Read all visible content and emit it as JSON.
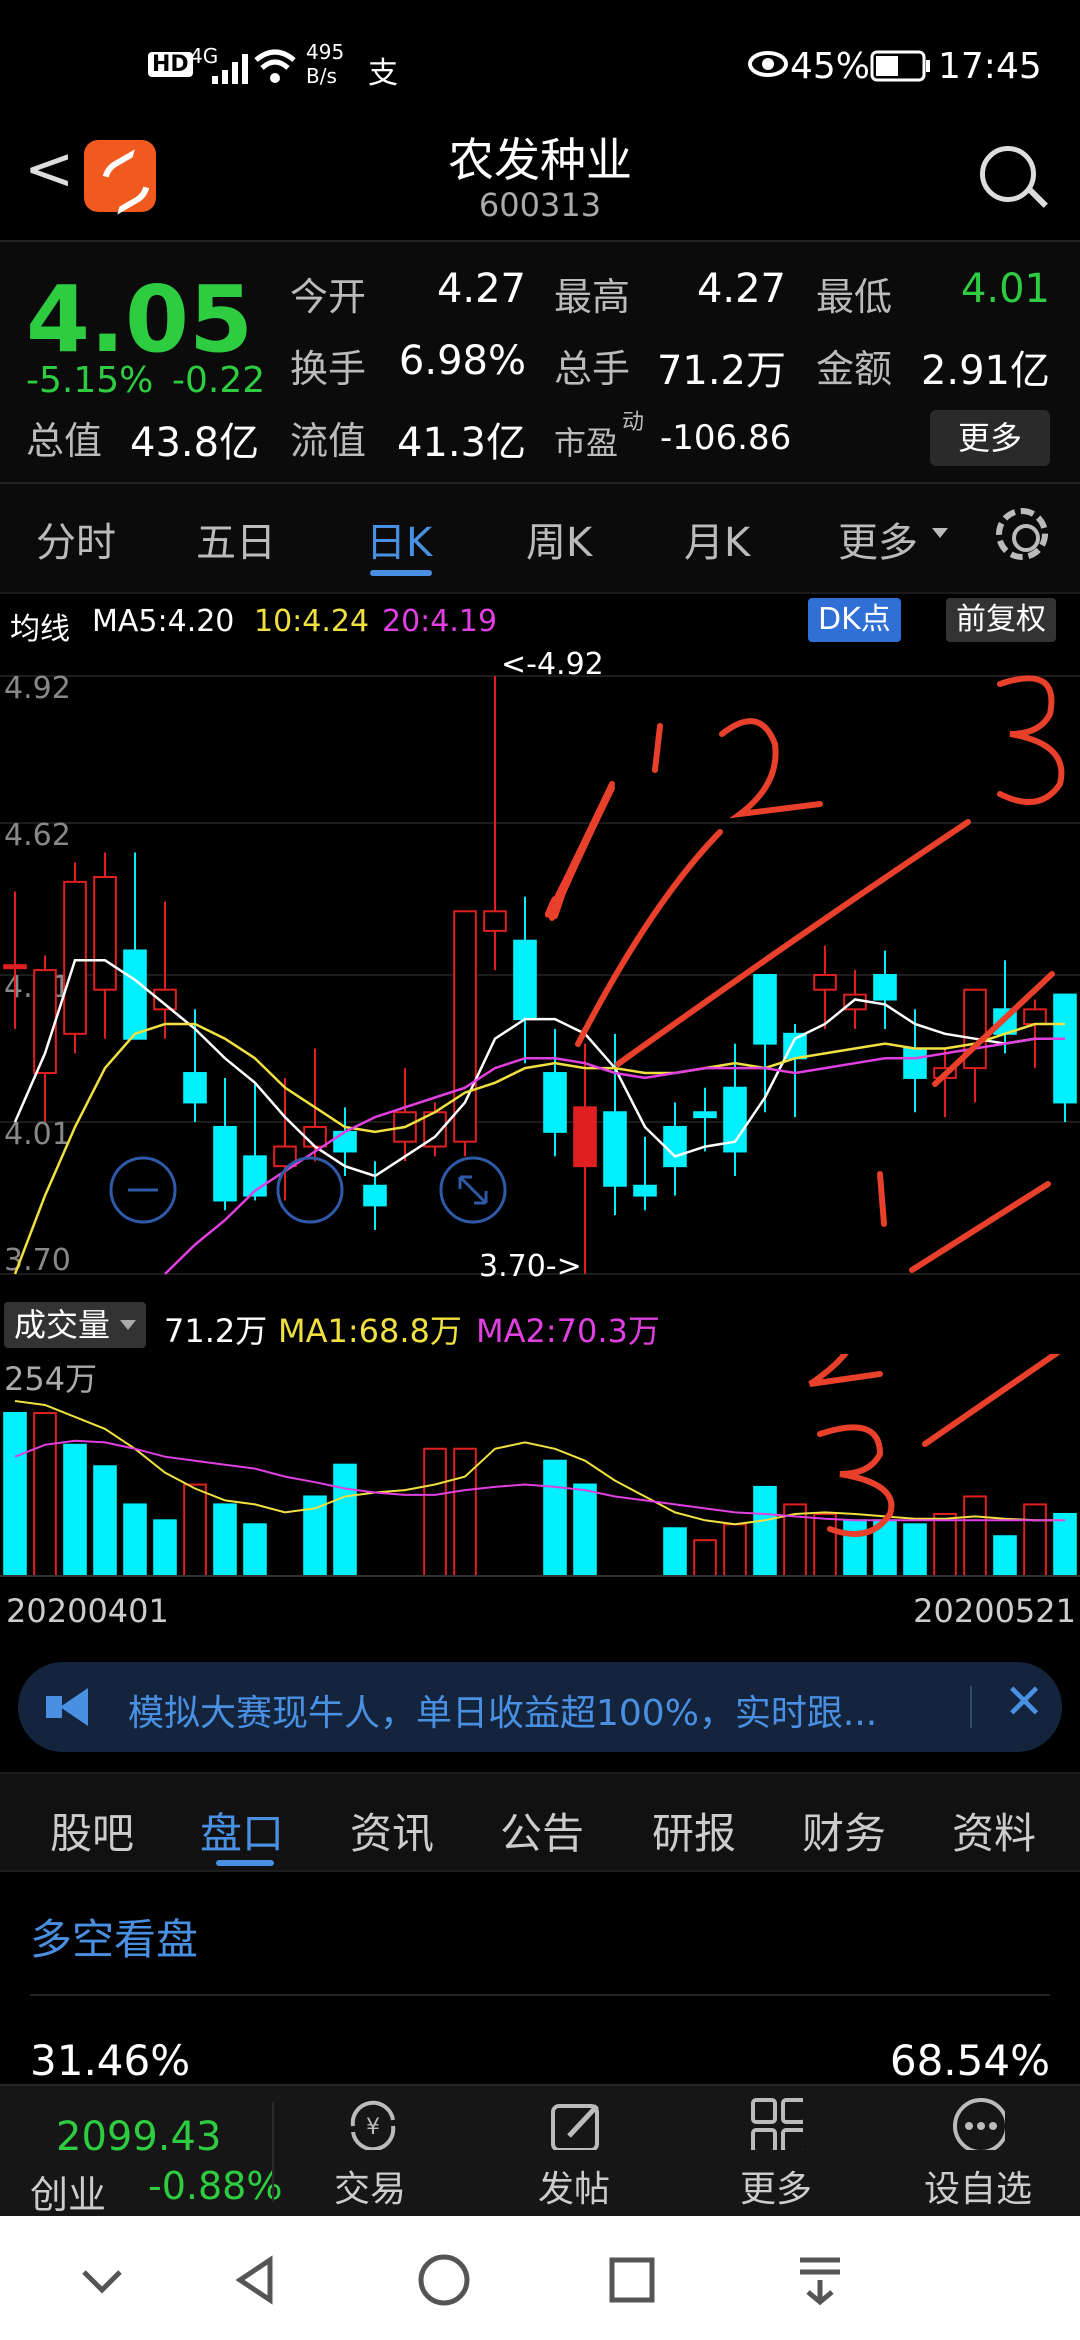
{
  "status_bar": {
    "hd": "HD",
    "network": "4G",
    "speed_value": "495",
    "speed_unit": "B/s",
    "pay_icon": "支",
    "battery": "45%",
    "time": "17:45"
  },
  "header": {
    "title": "农发种业",
    "code": "600313"
  },
  "quote": {
    "price": "4.05",
    "change_pct": "-5.15%",
    "change": "-0.22",
    "fields": {
      "open_label": "今开",
      "open": "4.27",
      "high_label": "最高",
      "high": "4.27",
      "low_label": "最低",
      "low": "4.01",
      "turnover_label": "换手",
      "turnover": "6.98%",
      "volume_label": "总手",
      "volume": "71.2万",
      "amount_label": "金额",
      "amount": "2.91亿",
      "mktcap_label": "总值",
      "mktcap": "43.8亿",
      "float_label": "流值",
      "float": "41.3亿",
      "pe_label": "市盈",
      "pe_sup": "动",
      "pe": "-106.86"
    },
    "more_label": "更多"
  },
  "period_tabs": [
    "分时",
    "五日",
    "日K",
    "周K",
    "月K",
    "更多"
  ],
  "active_period": "日K",
  "ma_bar": {
    "label": "均线",
    "ma5": "MA5:4.20",
    "ma10": "10:4.24",
    "ma20": "20:4.19",
    "dk_label": "DK点",
    "fq_label": "前复权"
  },
  "colors": {
    "up": "#e02020",
    "down": "#00f0ff",
    "ma5": "#ffffff",
    "ma10": "#f0e040",
    "ma20": "#e040e0",
    "accent": "#4a90e2",
    "green": "#2ecc40",
    "annotation": "#e8402a"
  },
  "chart_data": {
    "type": "candlestick",
    "y_ticks": [
      "4.92",
      "4.62",
      "4.31",
      "4.01",
      "3.70"
    ],
    "ylim": [
      3.7,
      4.92
    ],
    "max_label": "<-4.92",
    "min_label": "3.70->",
    "start_date": "20200401",
    "end_date": "20200521",
    "candles": [
      {
        "o": 4.33,
        "h": 4.48,
        "l": 4.2,
        "c": 4.33,
        "d": 1
      },
      {
        "o": 4.11,
        "h": 4.35,
        "l": 4.01,
        "c": 4.32,
        "d": 1
      },
      {
        "o": 4.19,
        "h": 4.54,
        "l": 4.15,
        "c": 4.5,
        "d": 1
      },
      {
        "o": 4.28,
        "h": 4.56,
        "l": 4.18,
        "c": 4.51,
        "d": 1
      },
      {
        "o": 4.36,
        "h": 4.56,
        "l": 4.19,
        "c": 4.18,
        "d": -1
      },
      {
        "o": 4.24,
        "h": 4.46,
        "l": 4.18,
        "c": 4.28,
        "d": 1
      },
      {
        "o": 4.11,
        "h": 4.24,
        "l": 4.01,
        "c": 4.05,
        "d": -1
      },
      {
        "o": 4.0,
        "h": 4.1,
        "l": 3.83,
        "c": 3.85,
        "d": -1
      },
      {
        "o": 3.94,
        "h": 4.09,
        "l": 3.85,
        "c": 3.86,
        "d": -1
      },
      {
        "o": 3.92,
        "h": 4.1,
        "l": 3.85,
        "c": 3.96,
        "d": 1
      },
      {
        "o": 3.96,
        "h": 4.16,
        "l": 3.93,
        "c": 4.0,
        "d": 1
      },
      {
        "o": 3.99,
        "h": 4.04,
        "l": 3.9,
        "c": 3.95,
        "d": -1
      },
      {
        "o": 3.88,
        "h": 3.93,
        "l": 3.79,
        "c": 3.84,
        "d": -1
      },
      {
        "o": 3.97,
        "h": 4.12,
        "l": 3.93,
        "c": 4.03,
        "d": 1
      },
      {
        "o": 3.96,
        "h": 4.05,
        "l": 3.94,
        "c": 4.03,
        "d": 1
      },
      {
        "o": 3.97,
        "h": 4.44,
        "l": 3.94,
        "c": 4.44,
        "d": 1
      },
      {
        "o": 4.4,
        "h": 4.92,
        "l": 4.32,
        "c": 4.44,
        "d": 1
      },
      {
        "o": 4.38,
        "h": 4.47,
        "l": 4.13,
        "c": 4.22,
        "d": -1
      },
      {
        "o": 4.11,
        "h": 4.2,
        "l": 3.94,
        "c": 3.99,
        "d": -1
      },
      {
        "o": 4.04,
        "h": 4.17,
        "l": 3.7,
        "c": 3.92,
        "d": 1
      },
      {
        "o": 3.88,
        "h": 4.19,
        "l": 3.82,
        "c": 4.03,
        "d": -1
      },
      {
        "o": 3.88,
        "h": 3.98,
        "l": 3.83,
        "c": 3.86,
        "d": -1
      },
      {
        "o": 3.92,
        "h": 4.05,
        "l": 3.86,
        "c": 4.0,
        "d": -1
      },
      {
        "o": 4.02,
        "h": 4.08,
        "l": 3.95,
        "c": 4.03,
        "d": -1
      },
      {
        "o": 3.95,
        "h": 4.17,
        "l": 3.9,
        "c": 4.08,
        "d": -1
      },
      {
        "o": 4.17,
        "h": 4.31,
        "l": 4.03,
        "c": 4.31,
        "d": -1
      },
      {
        "o": 4.14,
        "h": 4.21,
        "l": 4.02,
        "c": 4.19,
        "d": -1
      },
      {
        "o": 4.28,
        "h": 4.37,
        "l": 4.2,
        "c": 4.31,
        "d": 1
      },
      {
        "o": 4.24,
        "h": 4.32,
        "l": 4.2,
        "c": 4.27,
        "d": 1
      },
      {
        "o": 4.31,
        "h": 4.36,
        "l": 4.2,
        "c": 4.26,
        "d": -1
      },
      {
        "o": 4.16,
        "h": 4.24,
        "l": 4.03,
        "c": 4.1,
        "d": -1
      },
      {
        "o": 4.1,
        "h": 4.16,
        "l": 4.02,
        "c": 4.12,
        "d": 1
      },
      {
        "o": 4.12,
        "h": 4.25,
        "l": 4.05,
        "c": 4.28,
        "d": 1
      },
      {
        "o": 4.24,
        "h": 4.34,
        "l": 4.15,
        "c": 4.19,
        "d": -1
      },
      {
        "o": 4.21,
        "h": 4.26,
        "l": 4.12,
        "c": 4.24,
        "d": 1
      },
      {
        "o": 4.27,
        "h": 4.27,
        "l": 4.01,
        "c": 4.05,
        "d": -1
      }
    ],
    "ma5_series": [
      4.01,
      4.15,
      4.34,
      4.34,
      4.3,
      4.25,
      4.2,
      4.14,
      4.09,
      4.02,
      3.96,
      3.92,
      3.9,
      3.94,
      3.98,
      4.05,
      4.18,
      4.22,
      4.22,
      4.19,
      4.12,
      4.0,
      3.94,
      3.96,
      3.97,
      4.06,
      4.18,
      4.21,
      4.26,
      4.25,
      4.21,
      4.19,
      4.18,
      4.17,
      4.18,
      4.18
    ],
    "ma10_series": [
      3.7,
      3.86,
      4.0,
      4.12,
      4.19,
      4.21,
      4.21,
      4.18,
      4.14,
      4.08,
      4.04,
      4.0,
      3.99,
      4.0,
      4.03,
      4.07,
      4.09,
      4.12,
      4.13,
      4.12,
      4.12,
      4.11,
      4.11,
      4.12,
      4.13,
      4.12,
      4.14,
      4.15,
      4.16,
      4.17,
      4.16,
      4.16,
      4.17,
      4.19,
      4.21,
      4.21
    ],
    "ma20_series": [
      null,
      null,
      null,
      null,
      null,
      3.7,
      3.76,
      3.81,
      3.87,
      3.91,
      3.95,
      3.99,
      4.02,
      4.04,
      4.06,
      4.08,
      4.12,
      4.14,
      4.14,
      4.13,
      4.11,
      4.1,
      4.11,
      4.12,
      4.12,
      4.12,
      4.11,
      4.12,
      4.13,
      4.14,
      4.14,
      4.15,
      4.16,
      4.17,
      4.18,
      4.18
    ]
  },
  "volume": {
    "selector_label": "成交量",
    "vol": "71.2万",
    "ma1": "MA1:68.8万",
    "ma2": "MA2:70.3万",
    "max_tick": "254万",
    "bars": [
      205,
      205,
      165,
      138,
      90,
      70,
      115,
      90,
      65,
      0,
      100,
      140,
      0,
      0,
      160,
      160,
      0,
      0,
      145,
      115,
      0,
      0,
      60,
      45,
      65,
      112,
      90,
      78,
      70,
      70,
      65,
      78,
      100,
      50,
      90,
      78
    ],
    "dirs": [
      -1,
      1,
      -1,
      -1,
      -1,
      -1,
      1,
      -1,
      -1,
      1,
      -1,
      -1,
      1,
      1,
      1,
      1,
      1,
      1,
      -1,
      -1,
      1,
      1,
      -1,
      1,
      1,
      -1,
      1,
      1,
      -1,
      -1,
      -1,
      1,
      1,
      -1,
      1,
      -1
    ],
    "ma1_series": [
      220,
      215,
      200,
      185,
      160,
      130,
      110,
      95,
      90,
      80,
      85,
      100,
      105,
      108,
      115,
      125,
      160,
      168,
      160,
      145,
      120,
      100,
      80,
      70,
      65,
      70,
      78,
      80,
      78,
      75,
      72,
      72,
      75,
      72,
      70,
      70
    ],
    "ma2_series": [
      150,
      165,
      170,
      168,
      160,
      150,
      145,
      140,
      135,
      125,
      118,
      110,
      105,
      102,
      102,
      108,
      112,
      115,
      112,
      108,
      100,
      95,
      90,
      85,
      80,
      78,
      75,
      72,
      70,
      70,
      70,
      70,
      70,
      70,
      70,
      70
    ]
  },
  "banner": {
    "text": "模拟大赛现牛人，单日收益超100%，实时跟..."
  },
  "info_tabs": [
    "股吧",
    "盘口",
    "资讯",
    "公告",
    "研报",
    "财务",
    "资料"
  ],
  "active_info_tab": "盘口",
  "panel": {
    "title": "多空看盘",
    "left_pct": "31.46%",
    "right_pct": "68.54%"
  },
  "bottom_nav": {
    "index_value": "2099.43",
    "index_name": "创业",
    "index_change": "-0.88%",
    "items": [
      {
        "label": "交易",
        "icon": "yen-refresh-icon"
      },
      {
        "label": "发帖",
        "icon": "edit-icon"
      },
      {
        "label": "更多",
        "icon": "grid-icon"
      },
      {
        "label": "设自选",
        "icon": "ellipsis-circle-icon"
      }
    ]
  },
  "annotations": {
    "top_numbers": [
      "1",
      "2",
      "3"
    ],
    "bottom_numbers": [
      "1",
      "2",
      "3"
    ]
  }
}
